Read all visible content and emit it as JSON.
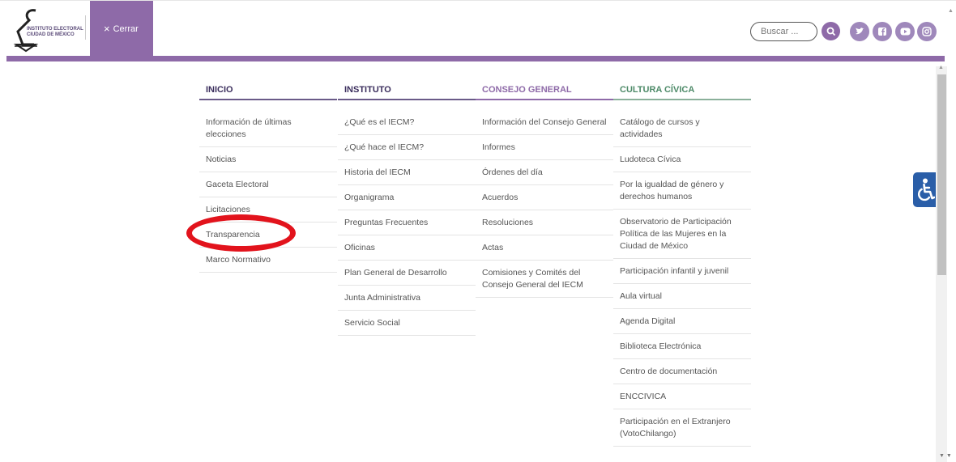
{
  "header": {
    "logo_text": "INSTITUTO ELECTORAL CIUDAD DE MÉXICO",
    "close_label": "Cerrar",
    "search_placeholder": "Buscar ...",
    "social": [
      "twitter-icon",
      "facebook-icon",
      "youtube-icon",
      "instagram-icon"
    ]
  },
  "menu": {
    "columns": [
      {
        "title": "INICIO",
        "items": [
          "Información de últimas elecciones",
          "Noticias",
          "Gaceta Electoral",
          "Licitaciones",
          "Transparencia",
          "Marco Normativo"
        ]
      },
      {
        "title": "INSTITUTO",
        "items": [
          "¿Qué es el IECM?",
          "¿Qué hace el IECM?",
          "Historia del IECM",
          "Organigrama",
          "Preguntas Frecuentes",
          "Oficinas",
          "Plan General de Desarrollo",
          "Junta Administrativa",
          "Servicio Social"
        ]
      },
      {
        "title": "CONSEJO GENERAL",
        "items": [
          "Información del Consejo General",
          "Informes",
          "Órdenes del día",
          "Acuerdos",
          "Resoluciones",
          "Actas",
          "Comisiones y Comités del Consejo General del IECM"
        ]
      },
      {
        "title": "CULTURA CÍVICA",
        "items": [
          "Catálogo de cursos y actividades",
          "Ludoteca Cívica",
          "Por la igualdad de género y derechos humanos",
          "Observatorio de Participación Política de las Mujeres en la Ciudad de México",
          "Participación infantil y juvenil",
          "Aula virtual",
          "Agenda Digital",
          "Biblioteca Electrónica",
          "Centro de documentación",
          "ENCCIVICA",
          "Participación en el Extranjero (VotoChilango)"
        ]
      }
    ]
  },
  "colors": {
    "purple": "#8e6aa8",
    "green": "#4d8a68",
    "accessibility_blue": "#2a5ea8",
    "highlight_red": "#e2131c"
  }
}
